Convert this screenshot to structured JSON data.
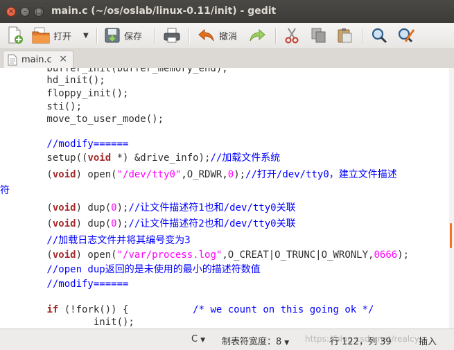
{
  "window": {
    "title": "main.c (~/os/oslab/linux-0.11/init) - gedit"
  },
  "toolbar": {
    "new_icon": "new-document-icon",
    "open_label": "打开",
    "save_label": "保存",
    "undo_label": "撤消"
  },
  "tab": {
    "label": "main.c",
    "close": "×"
  },
  "code": {
    "l0": "        buffer_init(buffer_memory_end);",
    "l1": "        hd_init();",
    "l2": "        floppy_init();",
    "l3": "        sti();",
    "l4": "        move_to_user_mode();",
    "l6": "        //modify======",
    "l7a": "        setup((",
    "l7kw": "void",
    "l7b": " *) &drive_info);",
    "l7c": "//加载文件系统",
    "l8a": "        (",
    "l8kw": "void",
    "l8b": ") open(",
    "l8s": "\"/dev/tty0\"",
    "l8c": ",O_RDWR,",
    "l8n": "0",
    "l8d": ");",
    "l8cm": "//打开/dev/tty0，建立文件描述",
    "l9": "符",
    "l11a": "        (",
    "l11kw": "void",
    "l11b": ") dup(",
    "l11n": "0",
    "l11c": ");",
    "l11cm": "//让文件描述符1也和/dev/tty0关联",
    "l12a": "        (",
    "l12kw": "void",
    "l12b": ") dup(",
    "l12n": "0",
    "l12c": ");",
    "l12cm": "//让文件描述符2也和/dev/tty0关联",
    "l13": "        //加载日志文件并将其编号变为3",
    "l14a": "        (",
    "l14kw": "void",
    "l14b": ") open(",
    "l14s": "\"/var/process.log\"",
    "l14c": ",O_CREAT|O_TRUNC|O_WRONLY,",
    "l14n": "0666",
    "l14d": ");",
    "l15": "        //open dup返回的是未使用的最小的描述符数值",
    "l16": "        //modify======",
    "l18a": "        ",
    "l18kw": "if",
    "l18b": " (!fork()) {           ",
    "l18cm": "/* we count on this going ok */",
    "l19": "                init();"
  },
  "status": {
    "language": "C",
    "tab_width": "制表符宽度：8",
    "position": "行 122，列 39",
    "mode": "插入",
    "watermark": "https://blog.csdn.net/realcy"
  },
  "colors": {
    "accent": "#f47421",
    "keyword": "#a52a2a",
    "string": "#ff00ff",
    "comment": "#0000ff"
  }
}
